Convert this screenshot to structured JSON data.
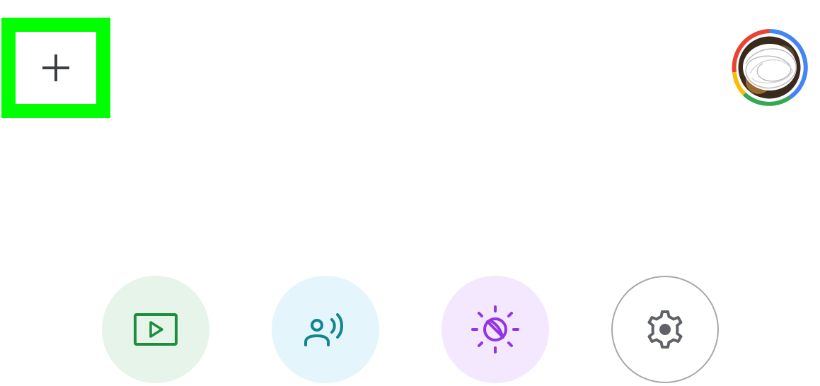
{
  "header": {
    "add_button": {
      "icon": "plus-icon",
      "highlight_color": "#00ff00"
    },
    "account": {
      "icon": "account-avatar",
      "ring_colors": [
        "#4285f4",
        "#ea4335",
        "#fbbc05",
        "#34a853"
      ]
    }
  },
  "shortcuts": [
    {
      "id": "media",
      "icon": "play-screen-icon",
      "background": "#e6f4ea",
      "icon_color": "#1e8e3e"
    },
    {
      "id": "voice",
      "icon": "voice-person-icon",
      "background": "#e4f5fb",
      "icon_color": "#12858f"
    },
    {
      "id": "ambient",
      "icon": "sun-moon-icon",
      "background": "#f3e8fd",
      "icon_color": "#9334e6"
    },
    {
      "id": "settings",
      "icon": "gear-icon",
      "background": "#ffffff",
      "icon_color": "#5f6368"
    }
  ]
}
